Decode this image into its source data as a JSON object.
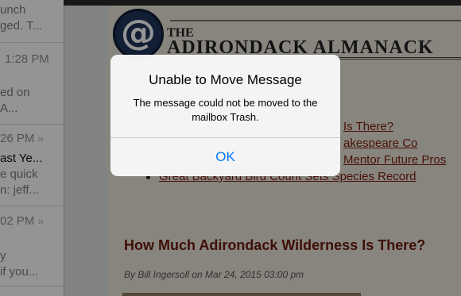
{
  "message_list": {
    "items": [
      {
        "lines": [
          "unch",
          "ged. T..."
        ]
      },
      {
        "time": "1:28 PM",
        "lines": [
          "ed on",
          "A..."
        ]
      },
      {
        "time": "26 PM",
        "lines": [
          "ast Ye...",
          "e quick",
          "n: jeff..."
        ]
      },
      {
        "time": "02 PM",
        "lines": [
          "y",
          " if you..."
        ]
      }
    ]
  },
  "content": {
    "masthead": {
      "the": "THE",
      "name": "ADIRONDACK ALMANACK",
      "logo_symbol": "@"
    },
    "links": [
      "Is There?",
      "akespeare Co",
      "Mentor Future Pros",
      "Great Backyard Bird Count Sets Species Record"
    ],
    "article_title": "How Much Adirondack Wilderness Is There?",
    "byline": "By Bill Ingersoll on Mar 24, 2015 03:00 pm"
  },
  "alert": {
    "title": "Unable to Move Message",
    "message": "The message could not be moved to the mailbox Trash.",
    "ok_label": "OK"
  },
  "colors": {
    "link": "#7a1d0f",
    "accent": "#007aff",
    "title": "#6b1a0c"
  },
  "icons": {
    "chevron": "chevron-right-double-icon"
  }
}
